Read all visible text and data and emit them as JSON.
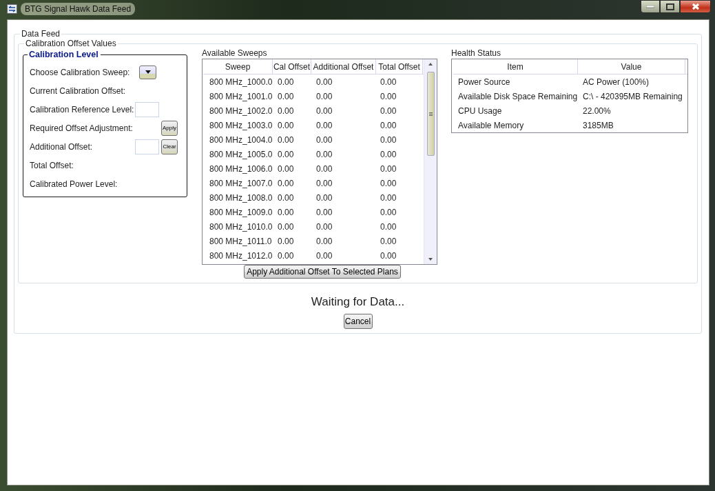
{
  "window": {
    "title": "BTG Signal Hawk Data Feed"
  },
  "data_feed": {
    "title": "Data Feed",
    "calibration_offset_values": {
      "title": "Calibration Offset Values",
      "calibration_level": {
        "title": "Calibration Level",
        "rows": [
          {
            "label": "Choose Calibration Sweep:",
            "kind": "dropdown"
          },
          {
            "label": "Current Calibration Offset:",
            "kind": "text"
          },
          {
            "label": "Calibration Reference Level:",
            "kind": "input"
          },
          {
            "label": "Required Offset Adjustment:",
            "kind": "button",
            "button": "Apply"
          },
          {
            "label": "Additional Offset:",
            "kind": "input_button",
            "button": "Clear"
          },
          {
            "label": "Total Offset:",
            "kind": "text"
          },
          {
            "label": "Calibrated Power Level:",
            "kind": "text"
          }
        ]
      },
      "available_sweeps": {
        "title": "Available Sweeps",
        "columns": [
          "Sweep",
          "Cal Offset",
          "Additional Offset",
          "Total Offset"
        ],
        "rows": [
          [
            "800 MHz_1000.0",
            "0.00",
            "0.00",
            "0.00"
          ],
          [
            "800 MHz_1001.0",
            "0.00",
            "0.00",
            "0.00"
          ],
          [
            "800 MHz_1002.0",
            "0.00",
            "0.00",
            "0.00"
          ],
          [
            "800 MHz_1003.0",
            "0.00",
            "0.00",
            "0.00"
          ],
          [
            "800 MHz_1004.0",
            "0.00",
            "0.00",
            "0.00"
          ],
          [
            "800 MHz_1005.0",
            "0.00",
            "0.00",
            "0.00"
          ],
          [
            "800 MHz_1006.0",
            "0.00",
            "0.00",
            "0.00"
          ],
          [
            "800 MHz_1007.0",
            "0.00",
            "0.00",
            "0.00"
          ],
          [
            "800 MHz_1008.0",
            "0.00",
            "0.00",
            "0.00"
          ],
          [
            "800 MHz_1009.0",
            "0.00",
            "0.00",
            "0.00"
          ],
          [
            "800 MHz_1010.0",
            "0.00",
            "0.00",
            "0.00"
          ],
          [
            "800 MHz_1011.0",
            "0.00",
            "0.00",
            "0.00"
          ],
          [
            "800 MHz_1012.0",
            "0.00",
            "0.00",
            "0.00"
          ]
        ]
      },
      "apply_button": "Apply Additional Offset To Selected Plans",
      "health_status": {
        "title": "Health Status",
        "columns": [
          "Item",
          "Value"
        ],
        "rows": [
          [
            "Power Source",
            "AC Power (100%)"
          ],
          [
            "Available Disk Space Remaining",
            "C:\\ - 420395MB Remaining"
          ],
          [
            "CPU Usage",
            "22.00%"
          ],
          [
            "Available Memory",
            "3185MB"
          ]
        ]
      }
    },
    "status": "Waiting for Data...",
    "cancel_button": "Cancel"
  }
}
